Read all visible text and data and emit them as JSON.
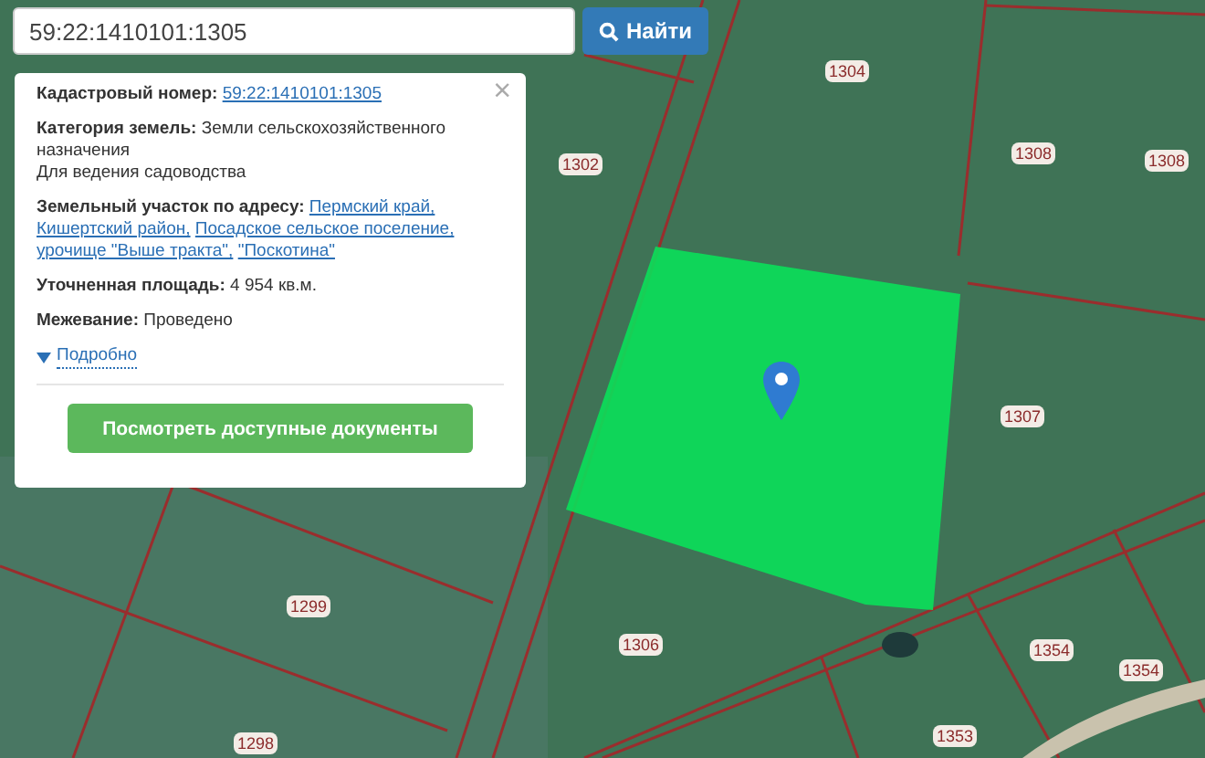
{
  "search": {
    "value": "59:22:1410101:1305",
    "button": "Найти"
  },
  "popup": {
    "cadastral": {
      "label": "Кадастровый номер:",
      "value": "59:22:1410101:1305"
    },
    "category": {
      "label": "Категория земель:",
      "value": "Земли сельскохозяйственного назначения",
      "use": "Для ведения садоводства"
    },
    "address": {
      "label": "Земельный участок по адресу:",
      "parts": [
        "Пермский край,",
        "Кишертский район,",
        "Посадское сельское поселение,",
        "урочище \"Выше тракта\",",
        "\"Поскотина\""
      ]
    },
    "area": {
      "label": "Уточненная площадь:",
      "value": "4 954 кв.м."
    },
    "survey": {
      "label": "Межевание:",
      "value": "Проведено"
    },
    "details": {
      "label": "Подробно",
      "expanded": false
    },
    "button": "Посмотреть доступные документы",
    "close": "×"
  },
  "map": {
    "labels": [
      "1304",
      "1302",
      "1308",
      "1308",
      "1307",
      "1306",
      "1354",
      "1354",
      "1353",
      "1299",
      "1298"
    ]
  }
}
